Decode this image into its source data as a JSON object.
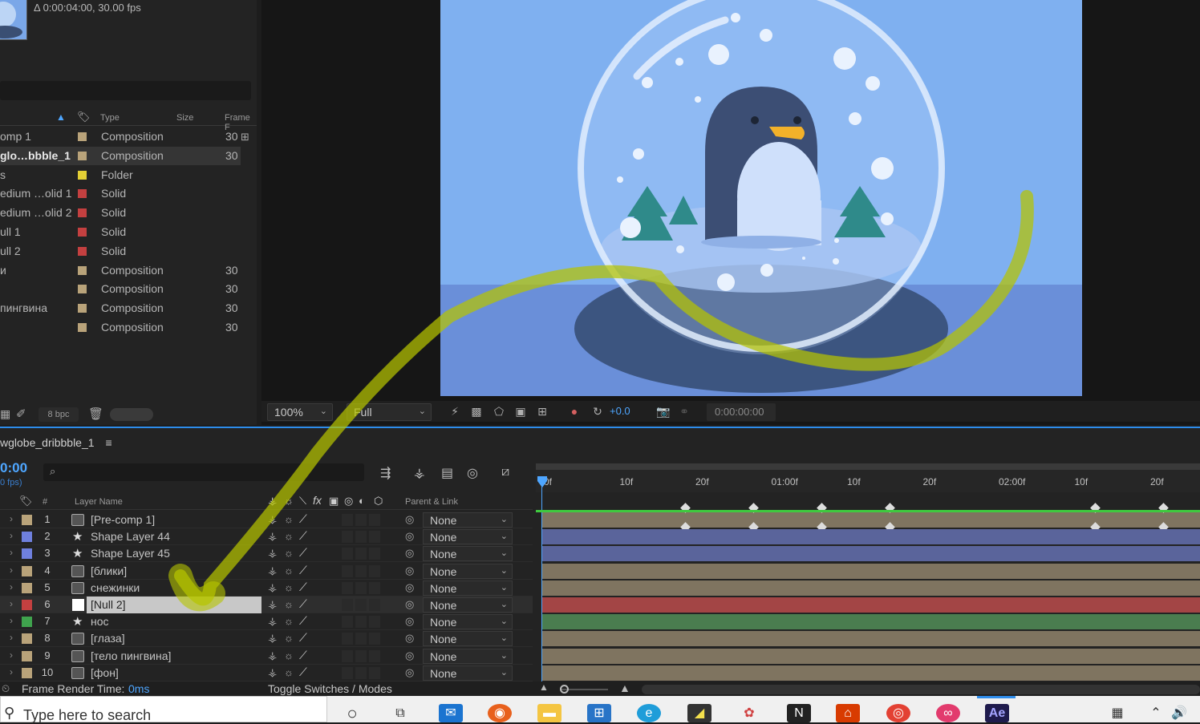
{
  "project": {
    "info": "Δ 0:00:04:00, 30.00 fps",
    "columns": {
      "type": "Type",
      "size": "Size",
      "frame": "Frame F"
    },
    "items": [
      {
        "name": "omp 1",
        "type": "Composition",
        "frame": "30",
        "color": "#b9a37a"
      },
      {
        "name": "glo…bbble_1",
        "type": "Composition",
        "frame": "30",
        "color": "#b9a37a",
        "selected": true
      },
      {
        "name": "s",
        "type": "Folder",
        "frame": "",
        "color": "#e3cf35"
      },
      {
        "name": "edium …olid 1",
        "type": "Solid",
        "frame": "",
        "color": "#c44040"
      },
      {
        "name": "edium …olid 2",
        "type": "Solid",
        "frame": "",
        "color": "#c44040"
      },
      {
        "name": "ull 1",
        "type": "Solid",
        "frame": "",
        "color": "#c44040"
      },
      {
        "name": "ull 2",
        "type": "Solid",
        "frame": "",
        "color": "#c44040"
      },
      {
        "name": "и",
        "type": "Composition",
        "frame": "30",
        "color": "#b9a37a"
      },
      {
        "name": "",
        "type": "Composition",
        "frame": "30",
        "color": "#b9a37a"
      },
      {
        "name": "пингвина",
        "type": "Composition",
        "frame": "30",
        "color": "#b9a37a"
      },
      {
        "name": "",
        "type": "Composition",
        "frame": "30",
        "color": "#b9a37a"
      }
    ],
    "bpc": "8 bpc"
  },
  "viewer": {
    "zoom": "100%",
    "resolution": "Full",
    "exposure": "+0.0",
    "timecode": "0:00:00:00"
  },
  "timeline": {
    "title": "wglobe_dribbble_1",
    "menu_icon": "≡",
    "current_time": "0:00",
    "fps": "0 fps)",
    "columns": {
      "num": "#",
      "layer_name": "Layer Name",
      "parent": "Parent & Link"
    },
    "ruler": [
      "0f",
      "10f",
      "20f",
      "01:00f",
      "10f",
      "20f",
      "02:00f",
      "10f",
      "20f"
    ],
    "layers": [
      {
        "num": "1",
        "name": "[Pre-comp 1]",
        "color": "#b9a37a",
        "bar": "#7f7460",
        "parent": "None",
        "star": false
      },
      {
        "num": "2",
        "name": "Shape Layer 44",
        "color": "#6f80de",
        "bar": "#5a649b",
        "parent": "None",
        "star": true
      },
      {
        "num": "3",
        "name": "Shape Layer 45",
        "color": "#6f80de",
        "bar": "#5a649b",
        "parent": "None",
        "star": true
      },
      {
        "num": "4",
        "name": "[блики]",
        "color": "#b9a37a",
        "bar": "#7f7460",
        "parent": "None",
        "star": false
      },
      {
        "num": "5",
        "name": "снежинки",
        "color": "#b9a37a",
        "bar": "#7f7460",
        "parent": "None",
        "star": false
      },
      {
        "num": "6",
        "name": "[Null 2]",
        "color": "#c44040",
        "bar": "#a34545",
        "parent": "None",
        "star": false,
        "selected": true
      },
      {
        "num": "7",
        "name": "нос",
        "color": "#3fa34d",
        "bar": "#4a7d4f",
        "parent": "None",
        "star": true
      },
      {
        "num": "8",
        "name": "[глаза]",
        "color": "#b9a37a",
        "bar": "#7f7460",
        "parent": "None",
        "star": false
      },
      {
        "num": "9",
        "name": "[тело пингвина]",
        "color": "#b9a37a",
        "bar": "#7f7460",
        "parent": "None",
        "star": false
      },
      {
        "num": "10",
        "name": "[фон]",
        "color": "#b9a37a",
        "bar": "#7f7460",
        "parent": "None",
        "star": false
      }
    ],
    "render_time_label": "Frame Render Time:",
    "render_time_value": "0ms",
    "toggle_label": "Toggle Switches / Modes"
  },
  "taskbar": {
    "search_placeholder": "Type here to search",
    "apps": [
      "search-circle",
      "task-view",
      "mail",
      "firefox",
      "file-explorer",
      "store",
      "edge",
      "sticky-notes",
      "paint",
      "notion",
      "office",
      "chrome",
      "creative-cloud",
      "after-effects"
    ],
    "ae_label": "Ae"
  },
  "colors": {
    "accent": "#2d8ceb",
    "timecode": "#4ea6ff",
    "comp_bg": "#7fb0f0"
  }
}
